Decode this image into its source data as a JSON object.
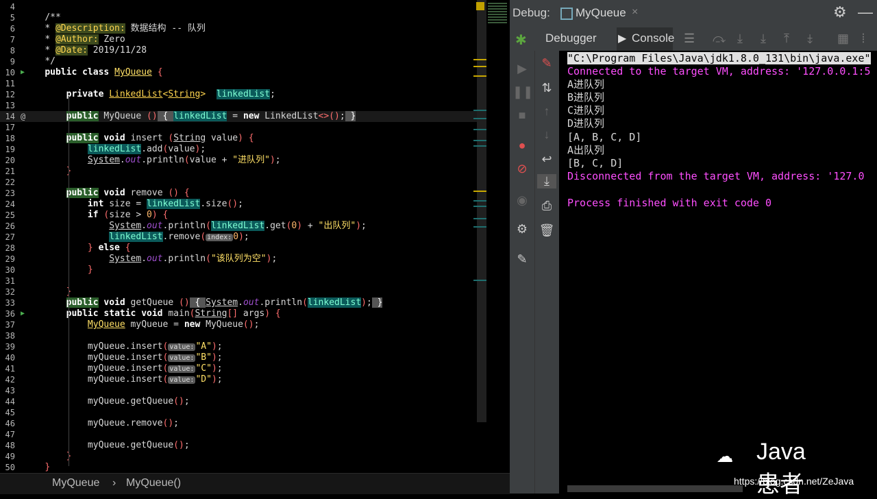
{
  "editor": {
    "lines": [
      {
        "n": "4",
        "html": ""
      },
      {
        "n": "5",
        "html": "    <span class='cm'>/**</span>"
      },
      {
        "n": "6",
        "html": "    <span class='cm'>* </span><span class='tag'>@Description:</span><span class='cm'> 数据结构 -- 队列</span>"
      },
      {
        "n": "7",
        "html": "    <span class='cm'>* </span><span class='tag'>@Author:</span><span class='cm'> Zero</span>"
      },
      {
        "n": "8",
        "html": "    <span class='cm'>* </span><span class='tag'>@Date:</span><span class='cm'> 2019/11/28</span>"
      },
      {
        "n": "9",
        "html": "    <span class='cm'>*/</span>"
      },
      {
        "n": "10",
        "html": "    <span class='kw'>public class</span> <span class='cls'>MyQueue</span> <span class='par'>{</span>"
      },
      {
        "n": "11",
        "html": ""
      },
      {
        "n": "12",
        "html": "        <span class='kw'>private</span> <span class='type uline'>LinkedList</span><span class='type'>&lt;</span><span class='type uline'>String</span><span class='type'>&gt;</span>  <span class='fld'>linkedList</span>;"
      },
      {
        "n": "13",
        "html": ""
      },
      {
        "n": "14",
        "html": "        <span class='kwh'>public</span> MyQueue <span class='par'>()</span><span class='fold'> { </span><span class='fld'>linkedList</span> = <span class='kw'>new</span> LinkedList<span class='par'>&lt;&gt;()</span>;<span class='fold'> }</span>",
        "cur": true
      },
      {
        "n": "17",
        "html": ""
      },
      {
        "n": "18",
        "html": "        <span class='kwh'>public</span> <span class='kw'>void</span> insert <span class='par'>(</span><span class='uline'>String</span> value<span class='par'>)</span> <span class='par'>{</span>"
      },
      {
        "n": "19",
        "html": "            <span class='fld'>linkedList</span>.add<span class='par'>(</span>value<span class='par'>)</span>;"
      },
      {
        "n": "20",
        "html": "            <span class='uline'>System</span>.<span class='ital'>out</span>.println<span class='par'>(</span>value + <span class='str'>\"进队列\"</span><span class='par'>)</span>;"
      },
      {
        "n": "21",
        "html": "        <span class='par'>}</span>"
      },
      {
        "n": "22",
        "html": ""
      },
      {
        "n": "23",
        "html": "        <span class='kwh'>public</span> <span class='kw'>void</span> remove <span class='par'>()</span> <span class='par'>{</span>"
      },
      {
        "n": "24",
        "html": "            <span class='kw'>int</span> size = <span class='fld'>linkedList</span>.size<span class='par'>()</span>;"
      },
      {
        "n": "25",
        "html": "            <span class='kw'>if</span> <span class='par'>(</span>size &gt; <span class='num'>0</span><span class='par'>)</span> <span class='par'>{</span>"
      },
      {
        "n": "26",
        "html": "                <span class='uline'>System</span>.<span class='ital'>out</span>.println<span class='par'>(</span><span class='fld'>linkedList</span>.get<span class='par'>(</span><span class='num'>0</span><span class='par'>)</span> + <span class='str'>\"出队列\"</span><span class='par'>)</span>;"
      },
      {
        "n": "27",
        "html": "                <span class='fld'>linkedList</span>.remove<span class='par'>(</span><span class='hint'>index:</span><span class='num'>0</span><span class='par'>)</span>;"
      },
      {
        "n": "28",
        "html": "            <span class='par'>}</span> <span class='kw'>else</span> <span class='par'>{</span>"
      },
      {
        "n": "29",
        "html": "                <span class='uline'>System</span>.<span class='ital'>out</span>.println<span class='par'>(</span><span class='str'>\"该队列为空\"</span><span class='par'>)</span>;"
      },
      {
        "n": "30",
        "html": "            <span class='par'>}</span>"
      },
      {
        "n": "31",
        "html": ""
      },
      {
        "n": "32",
        "html": "        <span class='par'>}</span>"
      },
      {
        "n": "33",
        "html": "        <span class='kwh'>public</span> <span class='kw'>void</span> getQueue <span class='par'>()</span><span class='fold'> { </span><span class='uline'>System</span>.<span class='ital'>out</span>.println<span class='par'>(</span><span class='fld'>linkedList</span><span class='par'>)</span>;<span class='fold'> }</span>"
      },
      {
        "n": "36",
        "html": "        <span class='kw'>public static void</span> main<span class='par'>(</span><span class='uline'>String</span><span class='par'>[]</span> args<span class='par'>)</span> <span class='par'>{</span>"
      },
      {
        "n": "37",
        "html": "            <span class='cls'>MyQueue</span> myQueue = <span class='kw'>new</span> MyQueue<span class='par'>()</span>;"
      },
      {
        "n": "38",
        "html": ""
      },
      {
        "n": "39",
        "html": "            myQueue.insert<span class='par'>(</span><span class='hint'>value:</span><span class='str'>\"A\"</span><span class='par'>)</span>;"
      },
      {
        "n": "40",
        "html": "            myQueue.insert<span class='par'>(</span><span class='hint'>value:</span><span class='str'>\"B\"</span><span class='par'>)</span>;"
      },
      {
        "n": "41",
        "html": "            myQueue.insert<span class='par'>(</span><span class='hint'>value:</span><span class='str'>\"C\"</span><span class='par'>)</span>;"
      },
      {
        "n": "42",
        "html": "            myQueue.insert<span class='par'>(</span><span class='hint'>value:</span><span class='str'>\"D\"</span><span class='par'>)</span>;"
      },
      {
        "n": "43",
        "html": ""
      },
      {
        "n": "44",
        "html": "            myQueue.getQueue<span class='par'>()</span>;"
      },
      {
        "n": "45",
        "html": ""
      },
      {
        "n": "46",
        "html": "            myQueue.remove<span class='par'>()</span>;"
      },
      {
        "n": "47",
        "html": ""
      },
      {
        "n": "48",
        "html": "            myQueue.getQueue<span class='par'>()</span>;"
      },
      {
        "n": "49",
        "html": "        <span class='par'>}</span>"
      },
      {
        "n": "50",
        "html": "    <span class='par'>}</span>"
      }
    ],
    "breadcrumb": [
      "MyQueue",
      "›",
      "MyQueue()"
    ]
  },
  "debug": {
    "label": "Debug:",
    "tab_name": "MyQueue",
    "close": "×",
    "tabs": {
      "debugger": "Debugger",
      "console": "Console"
    },
    "console": [
      {
        "t": "\"C:\\Program Files\\Java\\jdk1.8.0_131\\bin\\java.exe\"",
        "k": "cmd"
      },
      {
        "t": "Connected to the target VM, address: '127.0.0.1:5",
        "k": "mag"
      },
      {
        "t": "A进队列",
        "k": "out"
      },
      {
        "t": "B进队列",
        "k": "out"
      },
      {
        "t": "C进队列",
        "k": "out"
      },
      {
        "t": "D进队列",
        "k": "out"
      },
      {
        "t": "[A, B, C, D]",
        "k": "out"
      },
      {
        "t": "A出队列",
        "k": "out"
      },
      {
        "t": "[B, C, D]",
        "k": "out"
      },
      {
        "t": "Disconnected from the target VM, address: '127.0",
        "k": "mag"
      },
      {
        "t": "",
        "k": "out"
      },
      {
        "t": "Process finished with exit code 0",
        "k": "mag"
      }
    ]
  },
  "watermark": {
    "brand": "Java患者",
    "url": "https://blog.csdn.net/ZeJava"
  },
  "colors": {
    "console_magenta": "#ff4fff",
    "accent_blue": "#4a88c7",
    "bug_green": "#5ca63f"
  }
}
